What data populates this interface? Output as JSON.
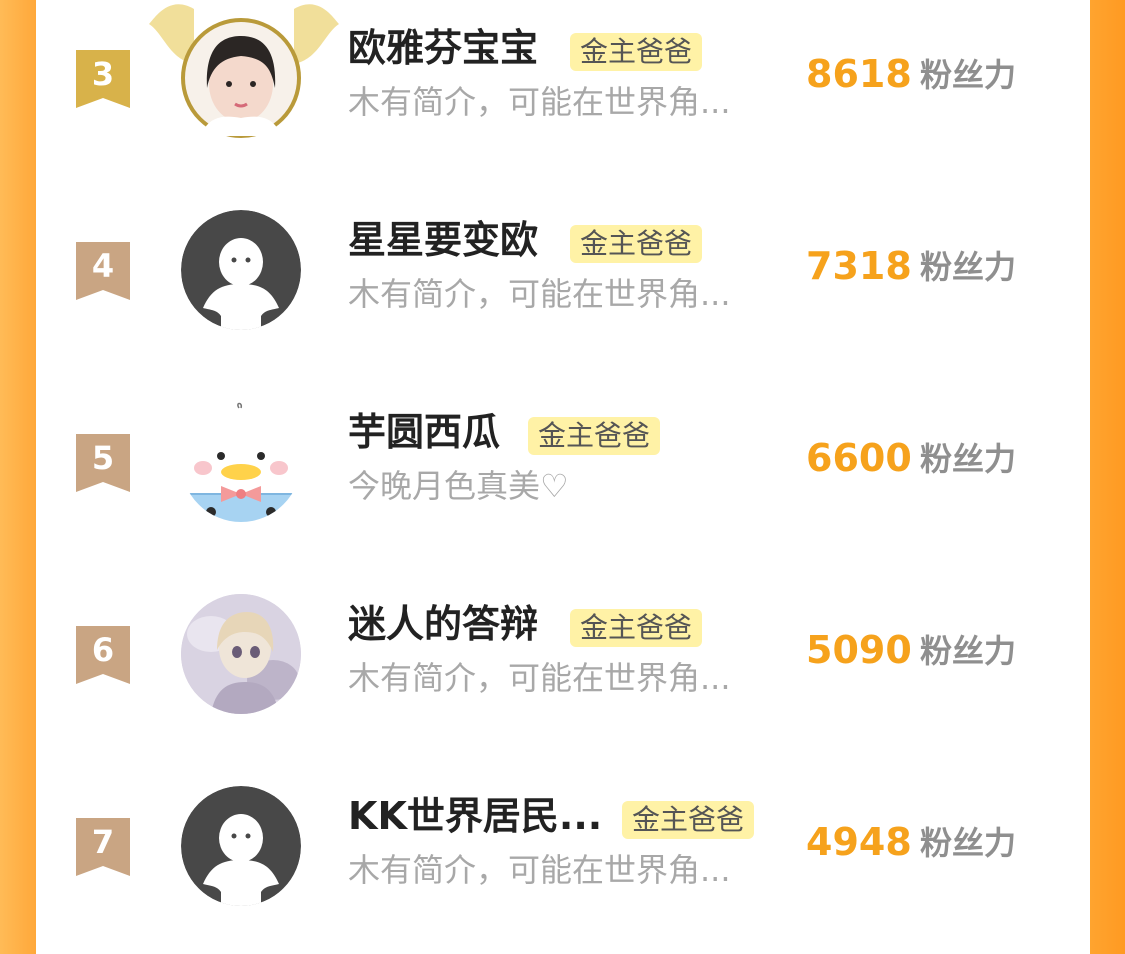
{
  "rows": [
    {
      "rank": "3",
      "name": "欧雅芬宝宝",
      "tag": "金主爸爸",
      "bio": "木有简介，可能在世界角...",
      "score": "8618",
      "unit": "粉丝力",
      "avatar": "photo-girl-avatar",
      "frame": "gold-crown-wings-icon",
      "badge_color": "#d8b24a"
    },
    {
      "rank": "4",
      "name": "星星要变欧",
      "tag": "金主爸爸",
      "bio": "木有简介，可能在世界角...",
      "score": "7318",
      "unit": "粉丝力",
      "avatar": "default-penguin-avatar",
      "badge_color": "#c9a583"
    },
    {
      "rank": "5",
      "name": "芋圆西瓜",
      "tag": "金主爸爸",
      "bio": "今晚月色真美♡",
      "score": "6600",
      "unit": "粉丝力",
      "avatar": "cartoon-duck-avatar",
      "badge_color": "#c9a583"
    },
    {
      "rank": "6",
      "name": "迷人的答辩",
      "tag": "金主爸爸",
      "bio": "木有简介，可能在世界角...",
      "score": "5090",
      "unit": "粉丝力",
      "avatar": "anime-doll-avatar",
      "badge_color": "#c9a583"
    },
    {
      "rank": "7",
      "name": "KK世界居民...",
      "tag": "金主爸爸",
      "bio": "木有简介，可能在世界角...",
      "score": "4948",
      "unit": "粉丝力",
      "avatar": "default-penguin-avatar",
      "badge_color": "#c9a583"
    }
  ],
  "colors": {
    "accent": "#f6a21c",
    "tag_bg": "#fff2a6",
    "sidebar": "#ffa42f"
  }
}
